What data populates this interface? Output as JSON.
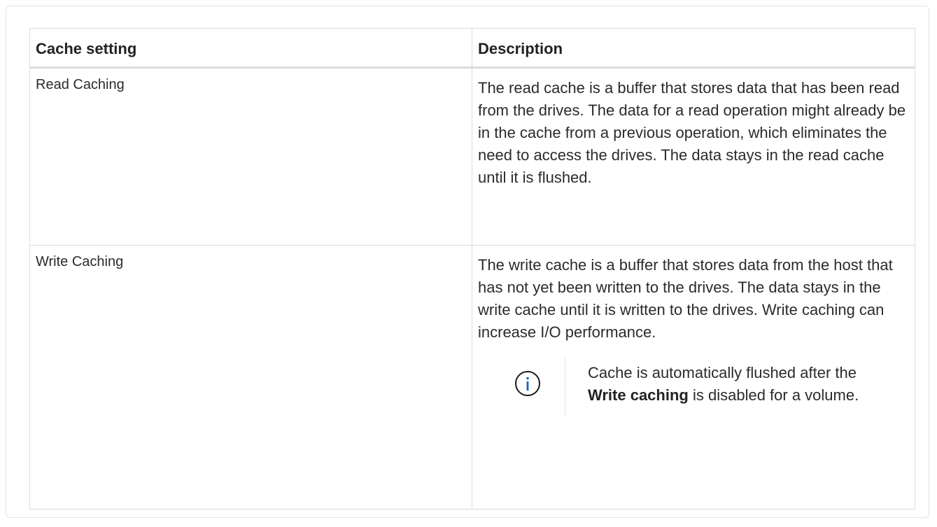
{
  "table": {
    "headers": {
      "setting": "Cache setting",
      "description": "Description"
    },
    "rows": [
      {
        "setting": "Read Caching",
        "description": "The read cache is a buffer that stores data that has been read from the drives. The data for a read operation might already be in the cache from a previous operation, which eliminates the need to access the drives. The data stays in the read cache until it is flushed."
      },
      {
        "setting": "Write Caching",
        "description": "The write cache is a buffer that stores data from the host that has not yet been written to the drives. The data stays in the write cache until it is written to the drives. Write caching can increase I/O performance.",
        "note": {
          "icon": "info-icon",
          "text_before": "Cache is automatically flushed after the ",
          "text_bold": "Write caching",
          "text_after": " is disabled for a volume."
        }
      }
    ]
  },
  "colors": {
    "info_icon": "#1565c0",
    "border": "#dcdcdc"
  }
}
